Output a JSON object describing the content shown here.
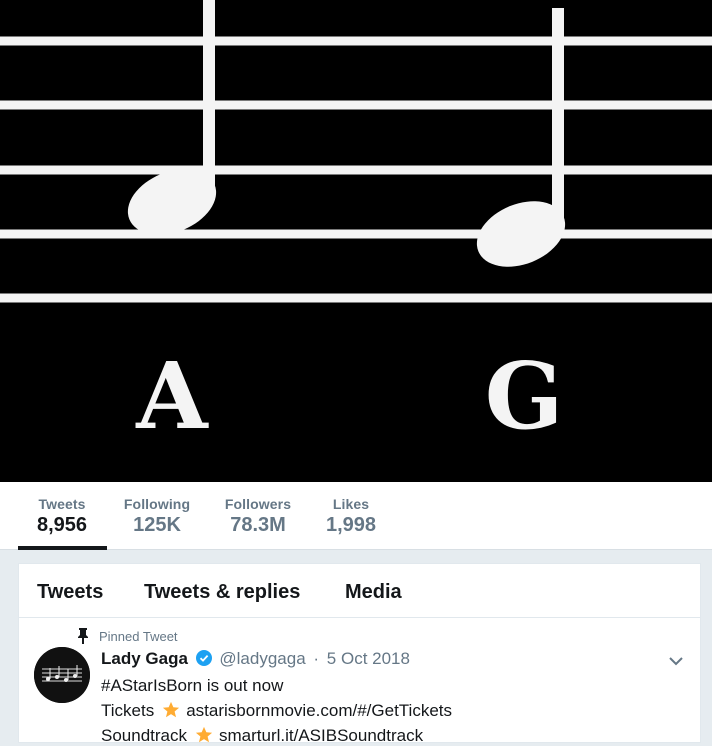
{
  "banner": {
    "letters": [
      "A",
      "G"
    ]
  },
  "stats": [
    {
      "label": "Tweets",
      "value": "8,956",
      "active": true
    },
    {
      "label": "Following",
      "value": "125K",
      "active": false
    },
    {
      "label": "Followers",
      "value": "78.3M",
      "active": false
    },
    {
      "label": "Likes",
      "value": "1,998",
      "active": false
    }
  ],
  "tabs": [
    "Tweets",
    "Tweets & replies",
    "Media"
  ],
  "pinned_tweet": {
    "pinned_label": "Pinned Tweet",
    "name": "Lady Gaga",
    "handle": "@ladygaga",
    "separator": "·",
    "date": "5 Oct 2018",
    "line1": "#AStarIsBorn is out now",
    "line2_label": "Tickets",
    "line2_link": "astarisbornmovie.com/#/GetTickets",
    "line3_label": "Soundtrack",
    "line3_link": "smarturl.it/ASIBSoundtrack"
  },
  "colors": {
    "accent": "#1da1f2",
    "star": "#ffac33",
    "muted": "#657786",
    "text": "#14171a"
  },
  "icons": [
    "pin-icon",
    "verified-icon",
    "chevron-down-icon",
    "star-icon"
  ]
}
